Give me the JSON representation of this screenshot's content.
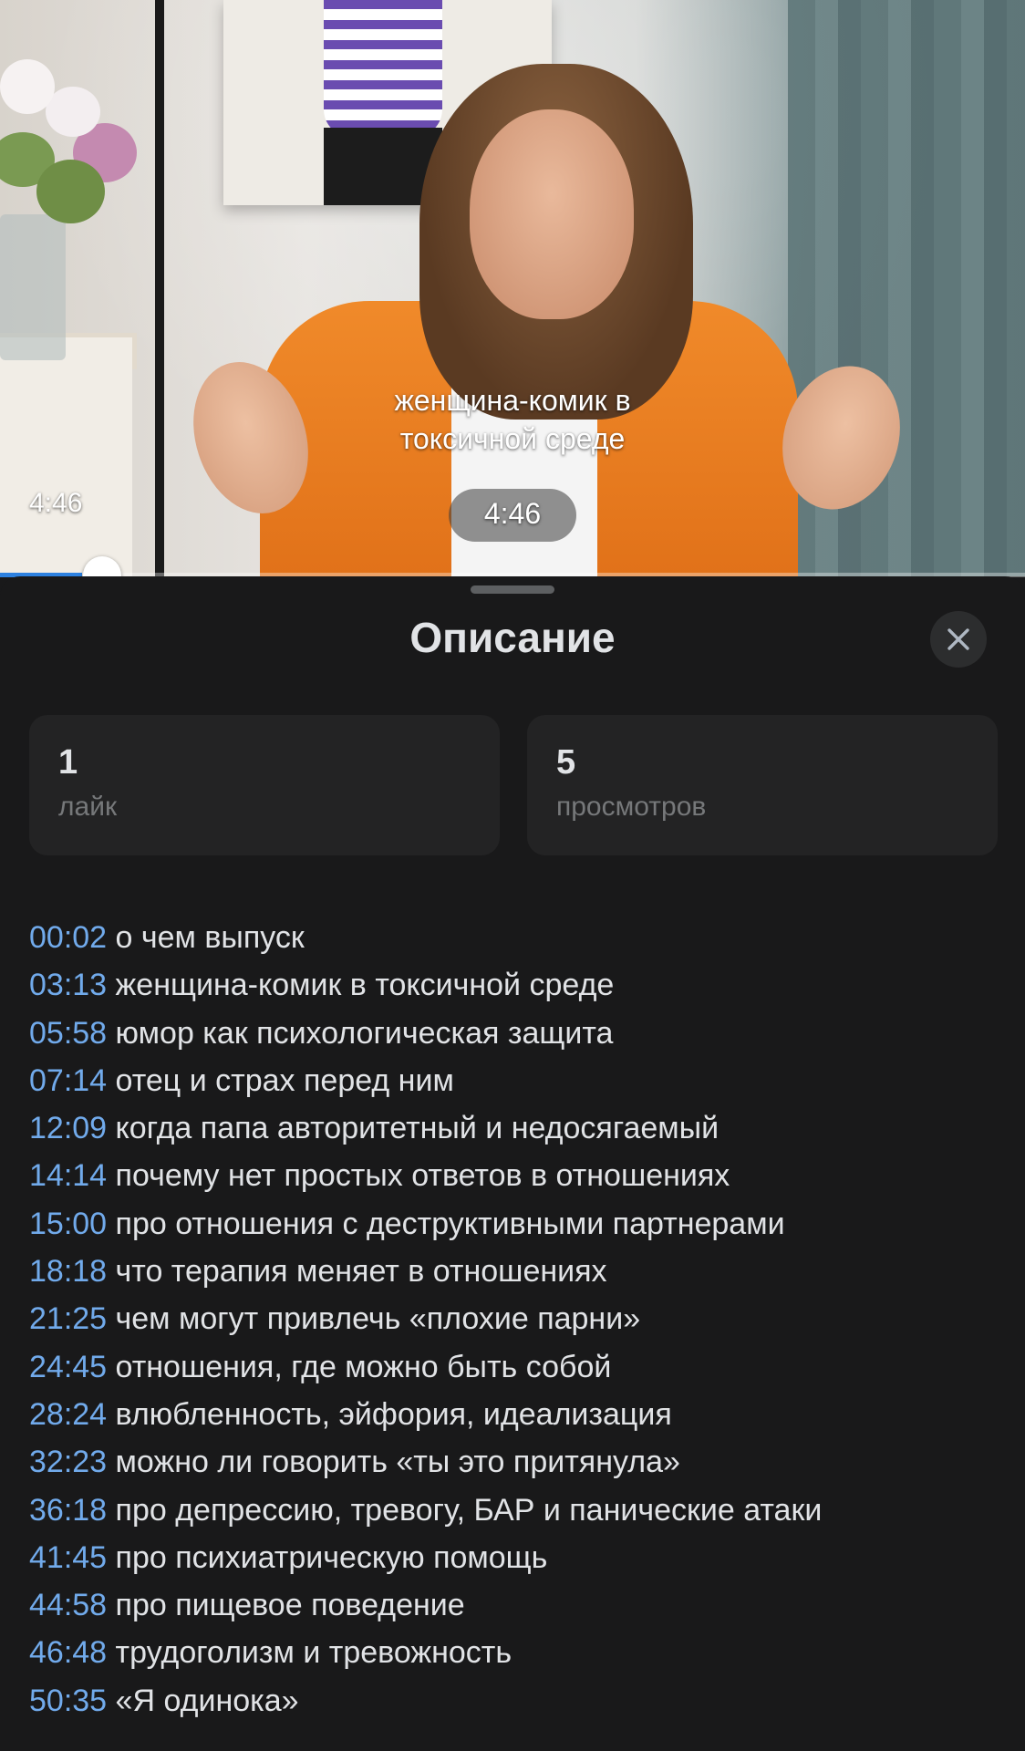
{
  "video": {
    "chapter_overlay_line1": "женщина-комик в",
    "chapter_overlay_line2": "токсичной среде",
    "time_center": "4:46",
    "time_left": "4:46",
    "progress_fraction": 0.1,
    "accent_color": "#2d81e0"
  },
  "sheet": {
    "title": "Описание",
    "close_icon": "close-icon"
  },
  "stats": {
    "likes": {
      "value": "1",
      "label": "лайк"
    },
    "views": {
      "value": "5",
      "label": "просмотров"
    }
  },
  "chapters": [
    {
      "time": "00:02",
      "title": "о чем выпуск"
    },
    {
      "time": "03:13",
      "title": "женщина-комик в токсичной среде"
    },
    {
      "time": "05:58",
      "title": "юмор как психологическая защита"
    },
    {
      "time": "07:14",
      "title": "отец и страх перед ним"
    },
    {
      "time": "12:09",
      "title": "когда папа авторитетный и недосягаемый"
    },
    {
      "time": "14:14",
      "title": "почему нет простых ответов в отношениях"
    },
    {
      "time": "15:00",
      "title": "про отношения с деструктивными партнерами"
    },
    {
      "time": "18:18",
      "title": "что терапия меняет в отношениях"
    },
    {
      "time": "21:25",
      "title": "чем могут привлечь «плохие парни»"
    },
    {
      "time": "24:45",
      "title": "отношения, где можно быть собой"
    },
    {
      "time": "28:24",
      "title": "влюбленность, эйфория, идеализация"
    },
    {
      "time": "32:23",
      "title": "можно ли говорить «ты это притянула»"
    },
    {
      "time": "36:18",
      "title": "про депрессию, тревогу, БАР и панические атаки"
    },
    {
      "time": "41:45",
      "title": "про психиатрическую помощь"
    },
    {
      "time": "44:58",
      "title": "про пищевое поведение"
    },
    {
      "time": "46:48",
      "title": "трудоголизм и тревожность"
    },
    {
      "time": "50:35",
      "title": "«Я одинока»"
    }
  ]
}
